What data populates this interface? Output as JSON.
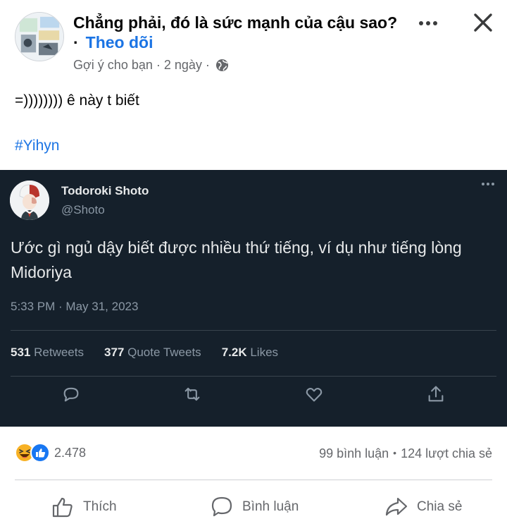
{
  "post": {
    "group_name": "Chẳng phải, đó là sức mạnh của cậu sao?",
    "follow_dot": "·",
    "follow_label": "Theo dõi",
    "suggestion": "Gợi ý cho bạn",
    "separator": "·",
    "time_ago": "2 ngày",
    "text": "=)))))))) ê này t biết",
    "hashtag": "#Yihyn"
  },
  "tweet": {
    "name": "Todoroki Shoto",
    "handle": "@Shoto",
    "body": "Ước gì ngủ dậy biết được nhiều thứ tiếng, ví dụ như tiếng lòng Midoriya",
    "timestamp": "5:33 PM · May 31, 2023",
    "retweets_count": "531",
    "retweets_label": "Retweets",
    "quotes_count": "377",
    "quotes_label": "Quote Tweets",
    "likes_count": "7.2K",
    "likes_label": "Likes",
    "background_color": "#15202b"
  },
  "engagement": {
    "reaction_count": "2.478",
    "comments": "99 bình luận",
    "dot": "•",
    "shares": "124 lượt chia sẻ"
  },
  "actions": {
    "like_label": "Thích",
    "comment_label": "Bình luận",
    "share_label": "Chia sẻ"
  },
  "colors": {
    "accent": "#1b74e4",
    "muted": "#65676b",
    "haha_reaction": "#f7b125",
    "like_reaction": "#1877f2"
  },
  "icons": [
    "globe-icon",
    "more-icon",
    "close-icon",
    "reply-icon",
    "retweet-icon",
    "heart-icon",
    "share-icon",
    "haha-reaction-icon",
    "like-reaction-icon",
    "thumbs-up-icon",
    "comment-icon",
    "forward-icon"
  ]
}
